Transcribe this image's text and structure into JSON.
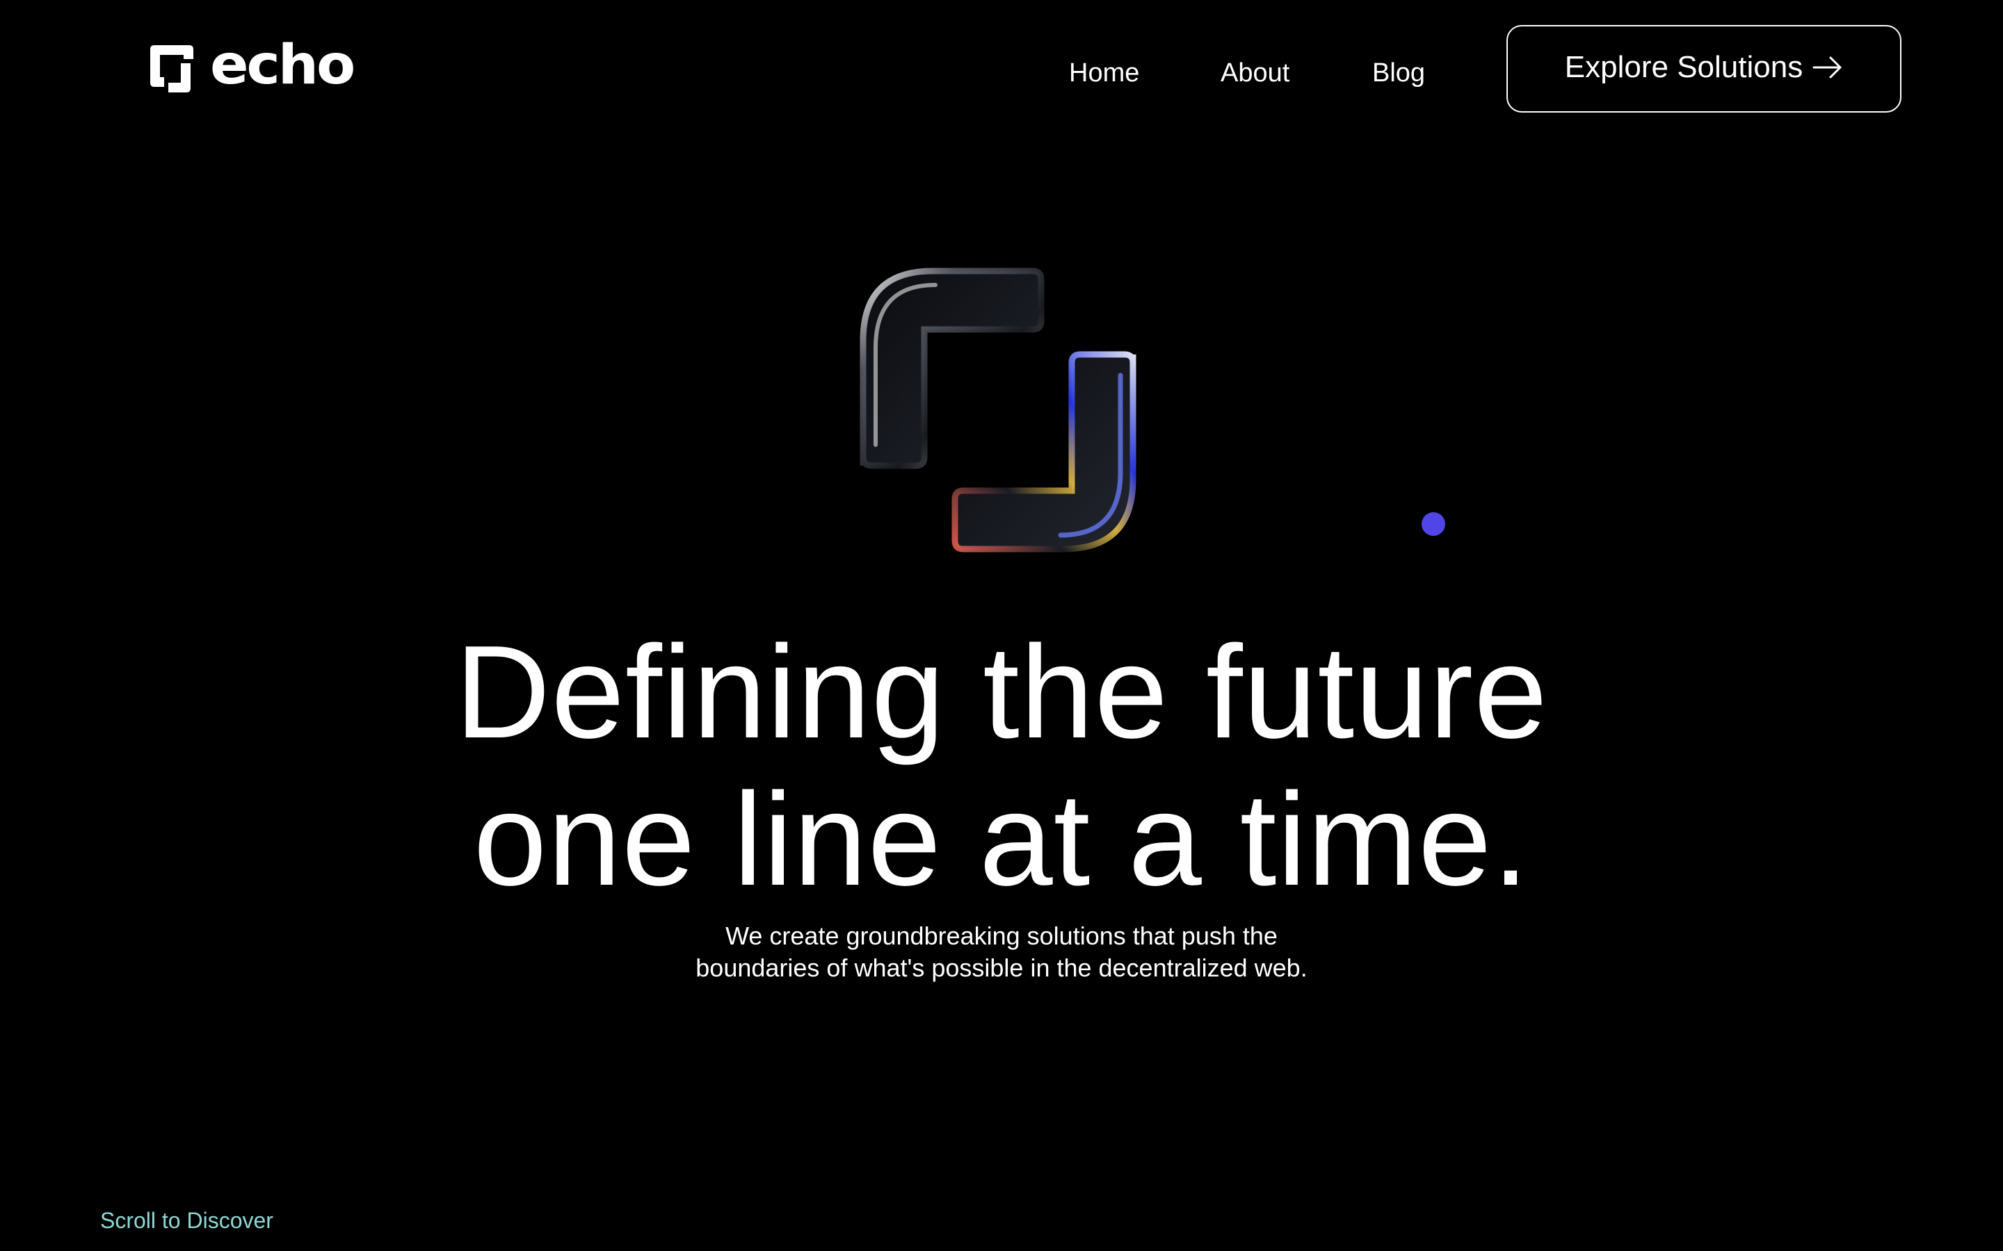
{
  "brand": {
    "name": "echo",
    "logo_icon": "echo-logo-mark-icon"
  },
  "nav": {
    "items": [
      {
        "label": "Home"
      },
      {
        "label": "About"
      },
      {
        "label": "Blog"
      }
    ],
    "cta": {
      "label": "Explore Solutions",
      "icon": "arrow-right-icon"
    }
  },
  "hero": {
    "graphic_icon": "glass-brackets-icon",
    "headline": {
      "line1": "Defining the future",
      "line2": "one line at a time."
    },
    "subtitle": {
      "line1": "We create groundbreaking solutions that push the",
      "line2": "boundaries of what's possible in the decentralized web."
    }
  },
  "scroll_hint": "Scroll to Discover",
  "colors": {
    "background": "#000000",
    "text": "#ffffff",
    "accent_dot": "#5046e8",
    "scroll_hint": "#8fd8d6"
  }
}
